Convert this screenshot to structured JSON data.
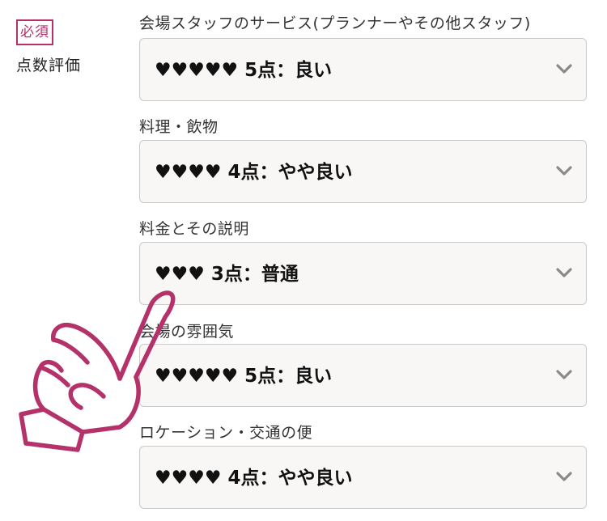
{
  "section": {
    "required_label": "必須",
    "title": "点数評価"
  },
  "fields": [
    {
      "label": "会場スタッフのサービス(プランナーやその他スタッフ)",
      "value": "♥♥♥♥♥ 5点：良い"
    },
    {
      "label": "料理・飲物",
      "value": "♥♥♥♥ 4点：やや良い"
    },
    {
      "label": "料金とその説明",
      "value": "♥♥♥ 3点：普通"
    },
    {
      "label": "会場の雰囲気",
      "value": "♥♥♥♥♥ 5点：良い"
    },
    {
      "label": "ロケーション・交通の便",
      "value": "♥♥♥♥ 4点：やや良い"
    }
  ],
  "icons": {
    "select_chevron": "chevron-down-icon",
    "pointer": "pointing-hand-icon"
  },
  "colors": {
    "accent": "#b5316a",
    "select_bg": "#f8f7f5",
    "select_border": "#c9c9c9"
  }
}
